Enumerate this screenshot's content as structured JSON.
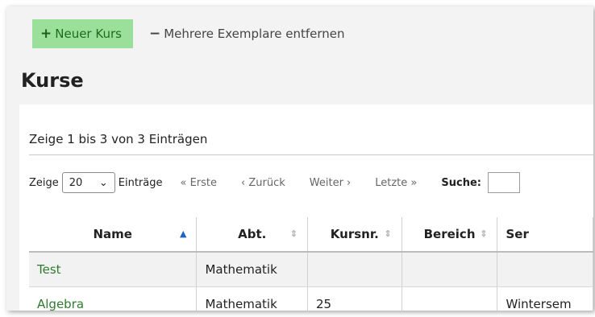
{
  "toolbar": {
    "new_course": "Neuer Kurs",
    "remove_copies": "Mehrere Exemplare entfernen"
  },
  "page_title": "Kurse",
  "info_text": "Zeige 1 bis 3 von 3 Einträgen",
  "length_menu": {
    "prefix": "Zeige",
    "value": "20",
    "suffix": "Einträge"
  },
  "pager": {
    "first": "« Erste",
    "prev": "‹ Zurück",
    "next": "Weiter ›",
    "last": "Letzte »"
  },
  "search_label": "Suche:",
  "table": {
    "headers": [
      "Name",
      "Abt.",
      "Kursnr.",
      "Bereich",
      "Ser"
    ],
    "rows": [
      [
        "Test",
        "Mathematik",
        "",
        "",
        ""
      ],
      [
        "Algebra",
        "Mathematik",
        "25",
        "",
        "Wintersem"
      ]
    ]
  }
}
